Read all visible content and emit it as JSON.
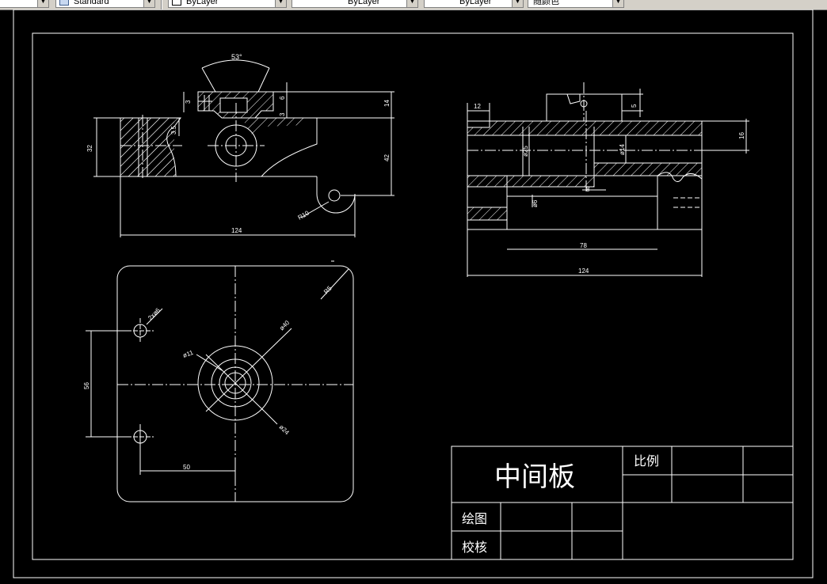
{
  "toolbar": {
    "text_style": "Standard",
    "layer": "ByLayer",
    "linetype": "ByLayer",
    "lineweight": "ByLayer",
    "plot_style": "随颜色"
  },
  "drawing": {
    "title_block": {
      "part_name": "中间板",
      "scale_label": "比例",
      "drawn_label": "绘图",
      "checked_label": "校核"
    },
    "front_view": {
      "angle": "53°",
      "dim_3_top": "3",
      "dim_6": "6",
      "dim_3_right": "3",
      "dim_3_5": "3.5",
      "dim_14": "14",
      "dim_32": "32",
      "dim_42": "42",
      "dim_r10": "R10",
      "dim_124": "124"
    },
    "side_view": {
      "dim_12": "12",
      "dim_5": "5",
      "dim_16": "16",
      "dim_d25": "ø25",
      "dim_d14": "ø14",
      "dim_8": "8",
      "dim_d6": "ø6",
      "dim_78": "78",
      "dim_124": "124"
    },
    "top_view": {
      "dim_r5": "R5",
      "dim_holes": "2xø6",
      "dim_d40": "ø40",
      "dim_d11": "ø11",
      "dim_d24": "ø24",
      "dim_56": "56",
      "dim_50": "50"
    }
  }
}
